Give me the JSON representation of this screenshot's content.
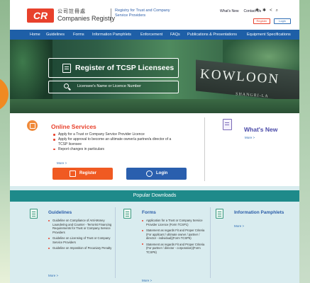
{
  "header": {
    "logo_mark": "CR",
    "logo_chinese": "公司註冊處",
    "logo_english": "Companies Registry",
    "tagline": "Registry for Trust and Company Service Providers",
    "links": [
      "What's New",
      "Contact Us"
    ],
    "register_label": "Register",
    "login_label": "Login"
  },
  "nav": {
    "items": [
      "Home",
      "Guidelines",
      "Forms",
      "Information Pamphlets",
      "Enforcement",
      "FAQs",
      "Publications & Presentations",
      "Equipment Specifications"
    ]
  },
  "hero": {
    "register_box": "Register of TCSP Licensees",
    "search_placeholder": "Licensee's Name or Licence Number",
    "sign_text": "KOWLOON",
    "sign_subtext": "SHANGRI-LA"
  },
  "services": {
    "title": "Online Services",
    "items": [
      "Apply for a Trust or Company Service Provider Licence",
      "Apply for approval to become an ultimate owner/a partner/a director of a TCSP licensee",
      "Report changes in particulars"
    ],
    "more": "More >",
    "register_label": "Register",
    "login_label": "Login"
  },
  "news": {
    "title": "What's New",
    "more": "More >"
  },
  "popular": {
    "title": "Popular Downloads",
    "columns": [
      {
        "title": "Guidelines",
        "items": [
          "Guideline on Compliance of Anti-Money Laundering and Counter - Terrorist Financing Requirements for Trust or Company Service Providers",
          "Guideline on Licensing of Trust or Company Service Providers",
          "Guideline on Imposition of Pecuniary Penalty"
        ],
        "more": "More >"
      },
      {
        "title": "Forms",
        "items": [
          "Application for a Trust or Company Service Provider Licence (Form TCSP1)",
          "Statement as regards Fit and Proper Criteria (For applicant / ultimate owner / partner / director - individual)(Form TCSP5)",
          "Statement as regards Fit and Proper Criteria (For partner / director - corporation)(Form TCSP6)"
        ],
        "more": "More >"
      },
      {
        "title": "Information Pamphlets",
        "items": [],
        "more": "More >"
      }
    ]
  },
  "colors": {
    "brand_red": "#e8412c",
    "nav_blue": "#1e5fa7",
    "register_orange": "#f05a22",
    "login_blue": "#2a5fae",
    "popular_teal": "#1e8a8a"
  }
}
